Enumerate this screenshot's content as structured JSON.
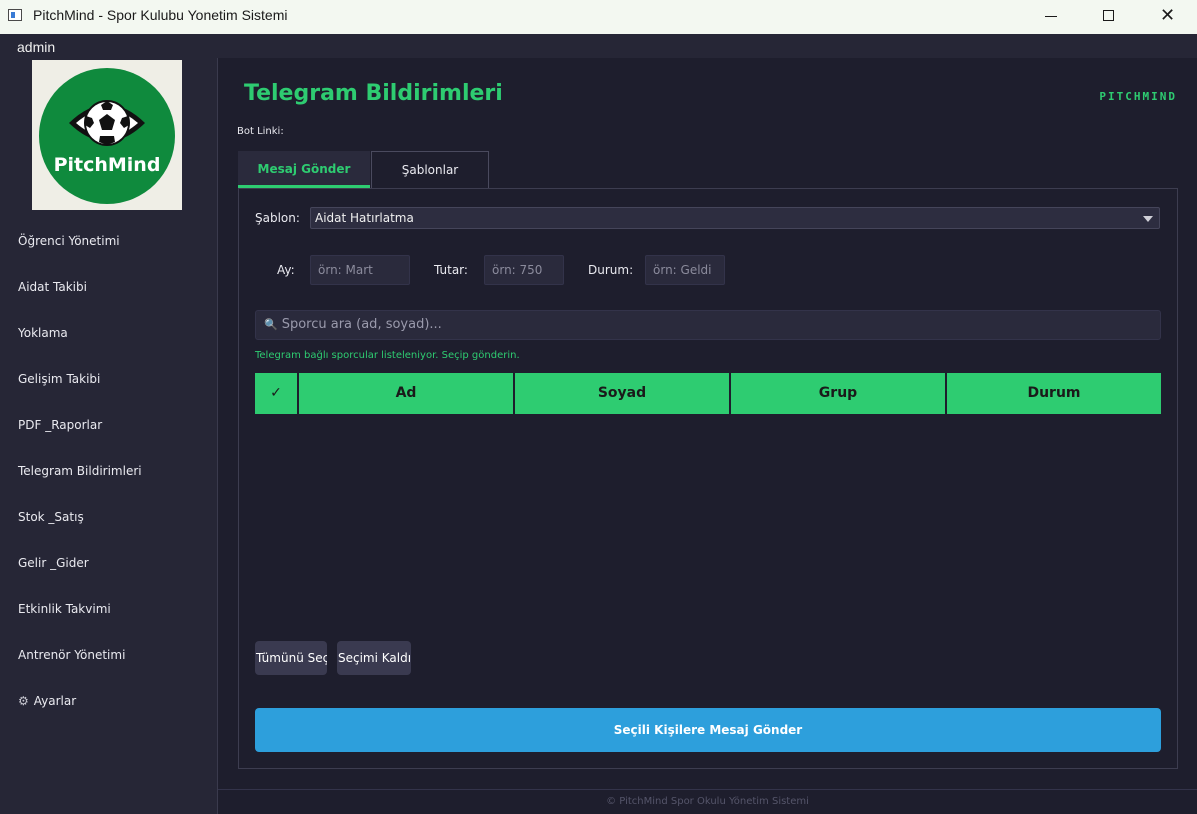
{
  "window": {
    "title": "PitchMind - Spor Kulubu Yonetim Sistemi"
  },
  "menubar": {
    "user": "admin"
  },
  "sidebar": {
    "logo_text": "PitchMind",
    "items": [
      {
        "label": "Öğrenci Yönetimi"
      },
      {
        "label": "Aidat Takibi"
      },
      {
        "label": "Yoklama"
      },
      {
        "label": "Gelişim Takibi"
      },
      {
        "label": "PDF _Raporlar"
      },
      {
        "label": "Telegram Bildirimleri"
      },
      {
        "label": "Stok _Satış"
      },
      {
        "label": "Gelir _Gider"
      },
      {
        "label": "Etkinlik Takvimi"
      },
      {
        "label": "Antrenör Yönetimi"
      },
      {
        "label": "Ayarlar",
        "icon": "gear-icon"
      }
    ]
  },
  "header": {
    "title": "Telegram Bildirimleri",
    "brand": "PITCHMIND",
    "bot_link_label": "Bot Linki:"
  },
  "tabs": [
    {
      "label": "Mesaj Gönder",
      "active": true
    },
    {
      "label": "Şablonlar",
      "active": false
    }
  ],
  "form": {
    "template_label": "Şablon:",
    "template_value": "Aidat Hatırlatma",
    "month_label": "Ay:",
    "month_placeholder": "örn: Mart",
    "amount_label": "Tutar:",
    "amount_placeholder": "örn: 750",
    "status_label": "Durum:",
    "status_placeholder": "örn: Geldi"
  },
  "search": {
    "placeholder": "Sporcu ara (ad, soyad)...",
    "icon": "search-icon"
  },
  "hint": "Telegram bağlı sporcular listeleniyor. Seçip gönderin.",
  "table": {
    "columns": [
      "✓",
      "Ad",
      "Soyad",
      "Grup",
      "Durum"
    ],
    "rows": []
  },
  "buttons": {
    "select_all": "Tümünü Seç",
    "clear_selection": "Seçimi Kaldır",
    "send": "Seçili Kişilere Mesaj Gönder"
  },
  "footer": "© PitchMind Spor Okulu Yönetim Sistemi",
  "colors": {
    "accent_green": "#2ecc71",
    "send_blue": "#2d9fdc",
    "background": "#1e1e2d",
    "sidebar": "#262636"
  }
}
